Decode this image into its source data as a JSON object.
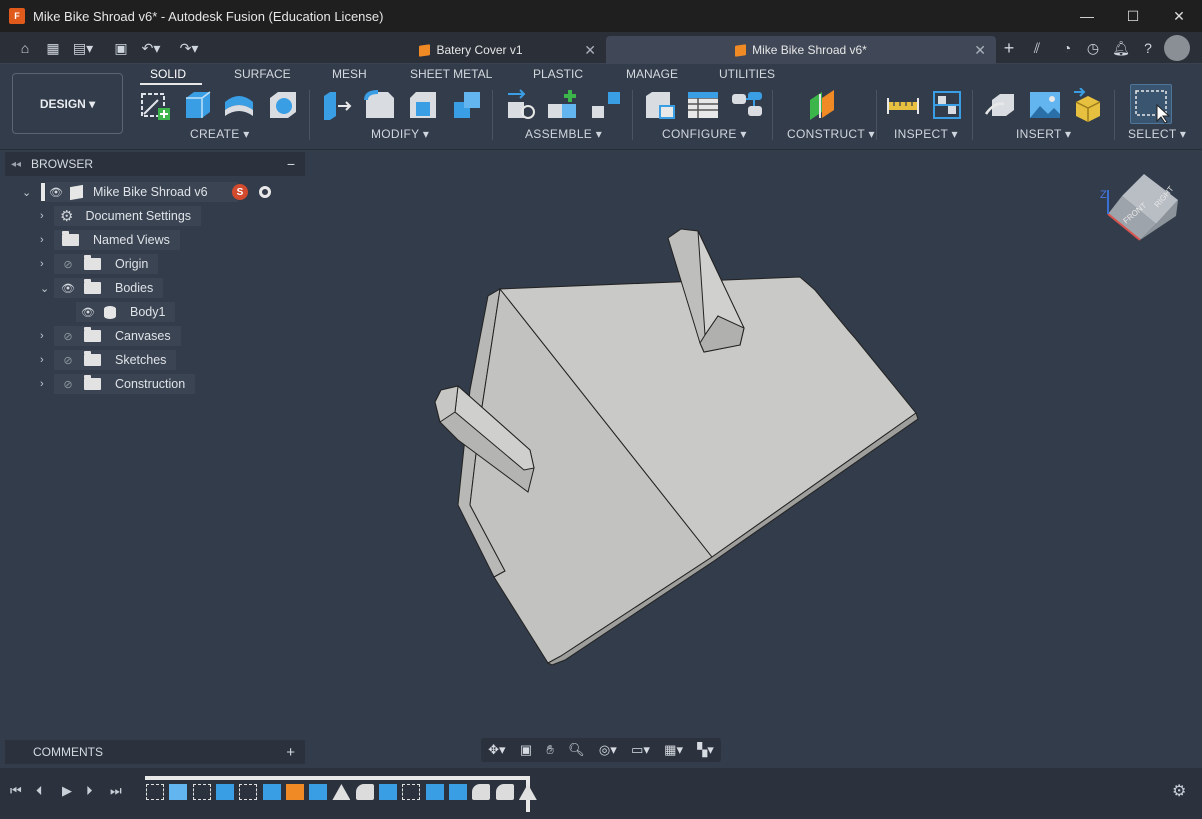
{
  "window": {
    "title": "Mike Bike Shroad v6* - Autodesk Fusion (Education License)",
    "logo_letter": "F"
  },
  "tabs": [
    {
      "label": "Batery Cover v1",
      "active": false
    },
    {
      "label": "Mike Bike Shroad v6*",
      "active": true
    }
  ],
  "workspace": {
    "label": "DESIGN ▾"
  },
  "ws_tabs": [
    "SOLID",
    "SURFACE",
    "MESH",
    "SHEET METAL",
    "PLASTIC",
    "MANAGE",
    "UTILITIES"
  ],
  "groups": {
    "create": "CREATE ▾",
    "modify": "MODIFY ▾",
    "assemble": "ASSEMBLE ▾",
    "configure": "CONFIGURE ▾",
    "construct": "CONSTRUCT ▾",
    "inspect": "INSPECT ▾",
    "insert": "INSERT ▾",
    "select": "SELECT ▾"
  },
  "browser": {
    "title": "BROWSER",
    "root": "Mike Bike Shroad v6",
    "items": [
      "Document Settings",
      "Named Views",
      "Origin",
      "Bodies",
      "Body1",
      "Canvases",
      "Sketches",
      "Construction"
    ]
  },
  "comments": {
    "title": "COMMENTS"
  },
  "viewcube": {
    "front": "FRONT",
    "right": "RIGHT",
    "axis": "Z"
  },
  "colors": {
    "accent": "#f08a24",
    "select": "#2f8fd0",
    "background": "#333c4a"
  }
}
